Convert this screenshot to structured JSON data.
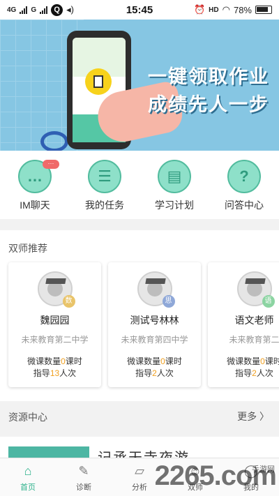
{
  "status_bar": {
    "carrier1": "4G",
    "carrier2": "G",
    "time": "15:45",
    "network": "HD",
    "battery": "78%"
  },
  "banner": {
    "line1": "一键领取作业",
    "line2": "成绩先人一步"
  },
  "quick_menu": [
    {
      "label": "IM聊天",
      "icon": "chat-icon",
      "badge": "···"
    },
    {
      "label": "我的任务",
      "icon": "task-list-icon"
    },
    {
      "label": "学习计划",
      "icon": "study-plan-icon"
    },
    {
      "label": "问答中心",
      "icon": "question-icon"
    }
  ],
  "teachers_section": {
    "title": "双师推荐"
  },
  "teachers": [
    {
      "name": "魏园园",
      "school": "未来教育第二中学",
      "subject": "数",
      "subject_color": "#e9c46a",
      "lessons_prefix": "微课数量",
      "lessons": "0",
      "lessons_suffix": "课时",
      "guide_prefix": "指导",
      "guided": "13",
      "guide_suffix": "人次"
    },
    {
      "name": "测试号林林",
      "school": "未来教育第四中学",
      "subject": "思",
      "subject_color": "#8fa8d8",
      "lessons_prefix": "微课数量",
      "lessons": "0",
      "lessons_suffix": "课时",
      "guide_prefix": "指导",
      "guided": "2",
      "guide_suffix": "人次"
    },
    {
      "name": "语文老师",
      "school": "未来教育第二",
      "subject": "语",
      "subject_color": "#8cd4a2",
      "lessons_prefix": "微课数量",
      "lessons": "0",
      "lessons_suffix": "课时",
      "guide_prefix": "指导",
      "guided": "2",
      "guide_suffix": "人次"
    }
  ],
  "resources": {
    "title": "资源中心",
    "more": "更多",
    "item_text": "记承天寺夜游"
  },
  "tabs": [
    {
      "label": "首页",
      "icon": "home-icon",
      "active": true
    },
    {
      "label": "诊断",
      "icon": "edit-icon",
      "active": false
    },
    {
      "label": "分析",
      "icon": "chart-icon",
      "active": false
    },
    {
      "label": "双师",
      "icon": "teacher-icon",
      "active": false
    },
    {
      "label": "我的",
      "icon": "profile-icon",
      "active": false
    }
  ],
  "watermark": {
    "text": "2265.com",
    "sub": "手游网"
  },
  "colors": {
    "accent": "#2fb28c",
    "number_highlight": "#f0a020",
    "badge": "#f06a6a"
  }
}
